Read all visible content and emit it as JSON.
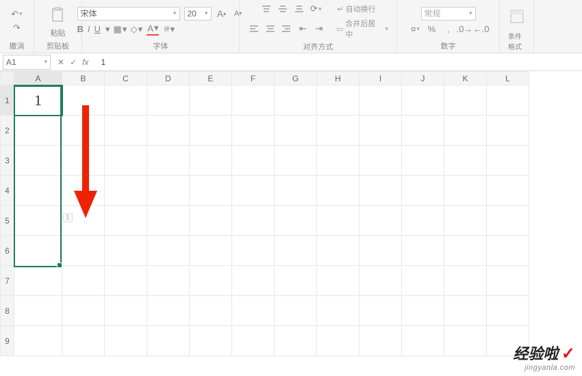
{
  "ribbon": {
    "undo_label": "撤消",
    "clipboard_label": "剪贴板",
    "paste_label": "粘贴",
    "font": {
      "label": "字体",
      "name": "宋体",
      "size": "20",
      "bold": "B",
      "italic": "I",
      "underline": "U",
      "increase": "A",
      "decrease": "A"
    },
    "align": {
      "label": "对齐方式",
      "wrap": "自动换行",
      "merge": "合并后居中"
    },
    "number": {
      "label": "数字",
      "format": "常规"
    },
    "cond_format": "条件格式"
  },
  "formula_bar": {
    "name_box": "A1",
    "cancel": "✕",
    "confirm": "✓",
    "fx": "fx",
    "value": "1"
  },
  "columns": [
    "A",
    "B",
    "C",
    "D",
    "E",
    "F",
    "G",
    "H",
    "I",
    "J",
    "K",
    "L"
  ],
  "rows": [
    "1",
    "2",
    "3",
    "4",
    "5",
    "6",
    "7",
    "8",
    "9"
  ],
  "cells": {
    "A1": "1"
  },
  "fill_hint": "1",
  "watermark": {
    "title": "经验啦",
    "check": "✓",
    "url": "jingyanla.com"
  }
}
